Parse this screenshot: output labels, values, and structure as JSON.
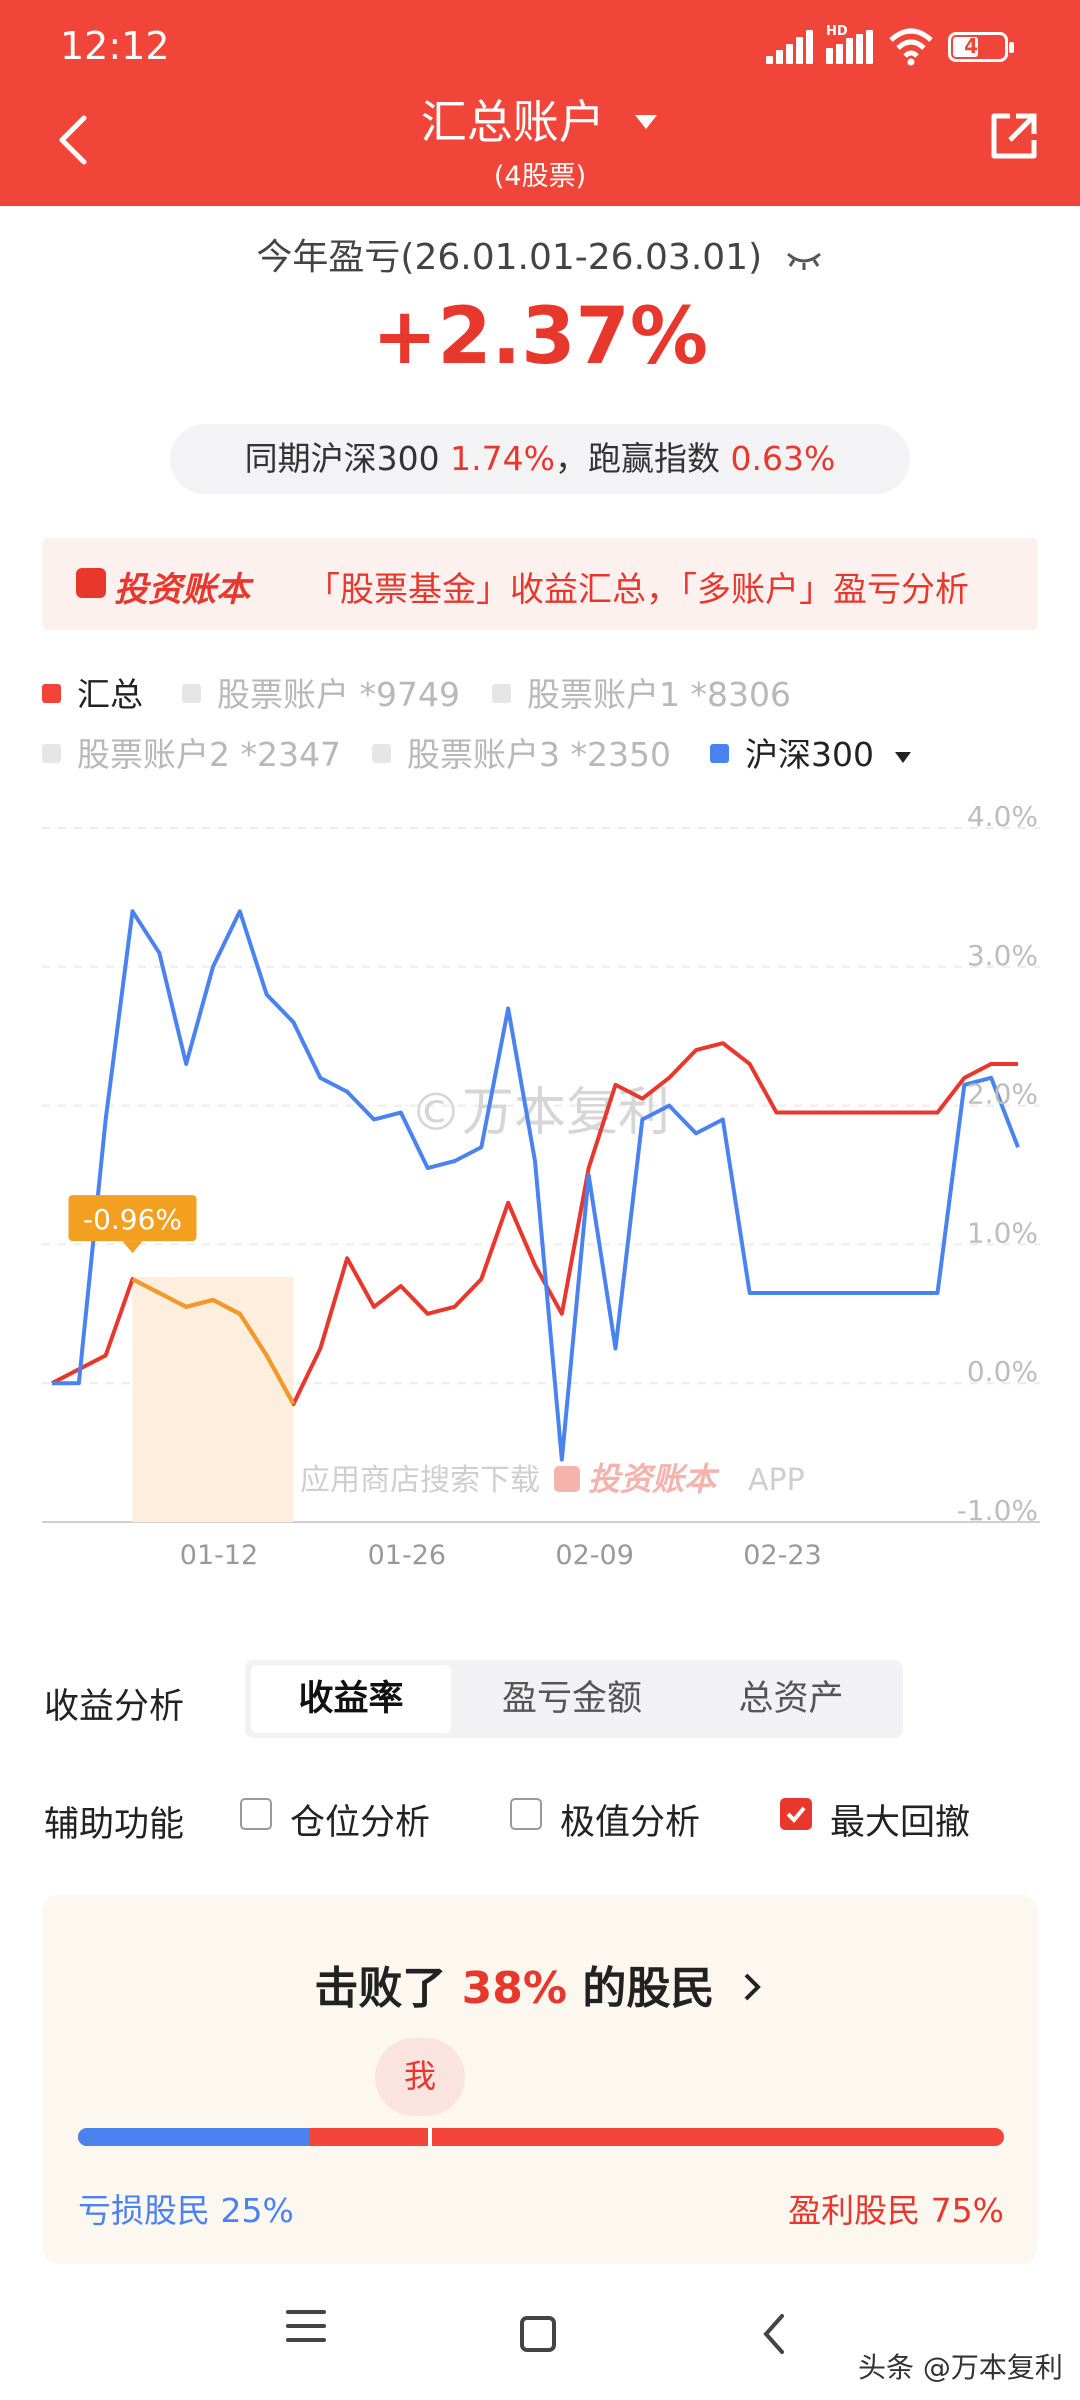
{
  "status": {
    "time": "12:12",
    "battery": "48",
    "hd": "HD"
  },
  "header": {
    "title": "汇总账户",
    "subtitle": "(4股票)",
    "back_icon": "chevron-left-icon",
    "share_icon": "share-icon"
  },
  "summary": {
    "period": "今年盈亏(26.01.01-26.03.01)",
    "return_value": "+2.37%",
    "compare_prefix": "同期沪深300",
    "compare_index": "1.74%",
    "compare_mid": "，跑赢指数",
    "compare_excess": "0.63%"
  },
  "banner": {
    "brand": "投资账本",
    "text": "「股票基金」收益汇总，「多账户」盈亏分析"
  },
  "legend": [
    {
      "label": "汇总",
      "color": "#f2453a",
      "active": true
    },
    {
      "label": "股票账户 *9749",
      "color": "#e6e6e6",
      "active": false
    },
    {
      "label": "股票账户1 *8306",
      "color": "#e6e6e6",
      "active": false
    },
    {
      "label": "股票账户2 *2347",
      "color": "#e6e6e6",
      "active": false
    },
    {
      "label": "股票账户3 *2350",
      "color": "#e6e6e6",
      "active": false
    },
    {
      "label": "沪深300",
      "color": "#4a82f0",
      "active": true
    }
  ],
  "chart_data": {
    "type": "line",
    "y_ticks": [
      "4.0%",
      "3.0%",
      "2.0%",
      "1.0%",
      "0.0%",
      "-1.0%"
    ],
    "ylim": [
      -1.0,
      4.0
    ],
    "x_ticks": [
      "01-12",
      "01-26",
      "02-09",
      "02-23"
    ],
    "max_drawdown_label": "-0.96%",
    "watermark": "©万本复利",
    "footer_text": "应用商店搜索下载",
    "footer_brand": "投资账本",
    "footer_app": "APP",
    "series": [
      {
        "name": "汇总",
        "color": "#e8372c",
        "values": [
          0.0,
          0.1,
          0.2,
          0.75,
          0.65,
          0.55,
          0.6,
          0.5,
          0.2,
          -0.15,
          0.25,
          0.9,
          0.55,
          0.7,
          0.5,
          0.55,
          0.75,
          1.3,
          0.85,
          0.5,
          1.55,
          2.15,
          2.05,
          2.2,
          2.4,
          2.45,
          2.3,
          1.95,
          1.95,
          1.95,
          1.95,
          1.95,
          1.95,
          1.95,
          2.2,
          2.3,
          2.3
        ]
      },
      {
        "name": "沪深300",
        "color": "#4a82f0",
        "values": [
          0.0,
          0.0,
          1.9,
          3.4,
          3.1,
          2.3,
          3.0,
          3.4,
          2.8,
          2.6,
          2.2,
          2.1,
          1.9,
          1.95,
          1.55,
          1.6,
          1.7,
          2.7,
          1.6,
          -0.55,
          1.5,
          0.25,
          1.9,
          2.0,
          1.8,
          1.9,
          0.65,
          0.65,
          0.65,
          0.65,
          0.65,
          0.65,
          0.65,
          0.65,
          2.15,
          2.2,
          1.7
        ]
      }
    ]
  },
  "analysis": {
    "label": "收益分析",
    "tabs": [
      "收益率",
      "盈亏金额",
      "总资产"
    ],
    "active": 0
  },
  "aux": {
    "label": "辅助功能",
    "options": [
      {
        "label": "仓位分析",
        "checked": false
      },
      {
        "label": "极值分析",
        "checked": false
      },
      {
        "label": "最大回撤",
        "checked": true
      }
    ]
  },
  "beat": {
    "prefix": "击败了",
    "percent": "38%",
    "suffix": "的股民",
    "me": "我",
    "loss_label": "亏损股民 25%",
    "gain_label": "盈利股民 75%",
    "loss_share": 0.25,
    "me_position": 0.38
  },
  "footer": {
    "source": "头条 @万本复利"
  }
}
